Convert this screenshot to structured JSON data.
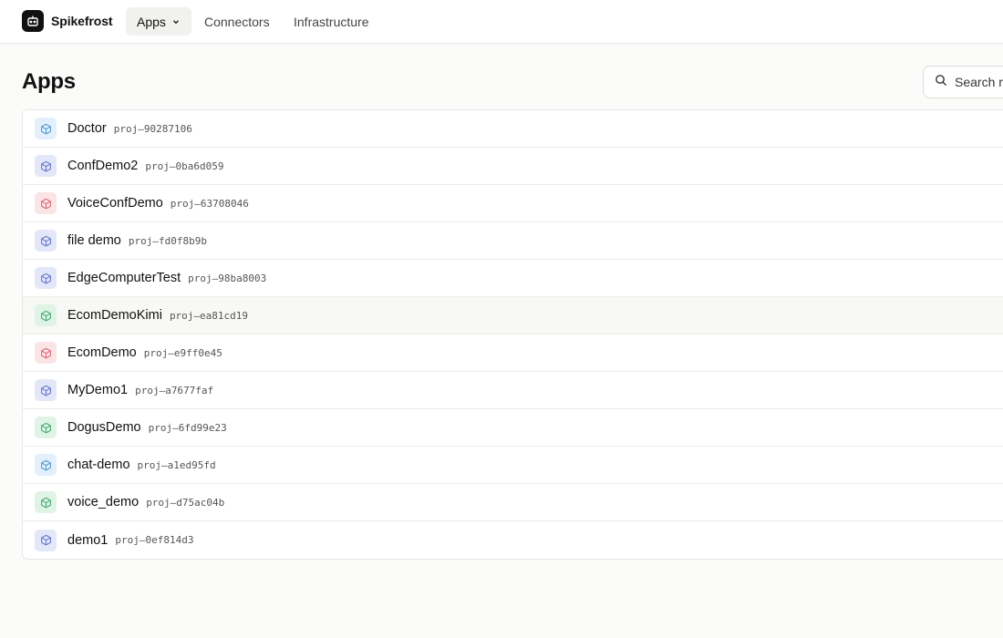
{
  "header": {
    "brand": "Spikefrost",
    "logo_icon": "robot-icon",
    "nav": [
      {
        "label": "Apps",
        "active": true,
        "icon": "chevron-down-icon"
      },
      {
        "label": "Connectors"
      },
      {
        "label": "Infrastructure"
      }
    ]
  },
  "main": {
    "title": "Apps",
    "search": {
      "placeholder": "Search m",
      "icon": "search-icon"
    },
    "apps": [
      {
        "name": "Doctor",
        "id": "proj—90287106",
        "icon": "box-icon",
        "color": "blue"
      },
      {
        "name": "ConfDemo2",
        "id": "proj—0ba6d059",
        "icon": "box-icon",
        "color": "indigo"
      },
      {
        "name": "VoiceConfDemo",
        "id": "proj—63708046",
        "icon": "box-icon",
        "color": "red"
      },
      {
        "name": "file demo",
        "id": "proj—fd0f8b9b",
        "icon": "box-icon",
        "color": "indigo"
      },
      {
        "name": "EdgeComputerTest",
        "id": "proj—98ba8003",
        "icon": "box-icon",
        "color": "indigo"
      },
      {
        "name": "EcomDemoKimi",
        "id": "proj—ea81cd19",
        "icon": "box-icon",
        "color": "green"
      },
      {
        "name": "EcomDemo",
        "id": "proj—e9ff0e45",
        "icon": "box-icon",
        "color": "red"
      },
      {
        "name": "MyDemo1",
        "id": "proj—a7677faf",
        "icon": "box-icon",
        "color": "indigo"
      },
      {
        "name": "DogusDemo",
        "id": "proj—6fd99e23",
        "icon": "box-icon",
        "color": "green"
      },
      {
        "name": "chat-demo",
        "id": "proj—a1ed95fd",
        "icon": "box-icon",
        "color": "blue"
      },
      {
        "name": "voice_demo",
        "id": "proj—d75ac04b",
        "icon": "box-icon",
        "color": "green"
      },
      {
        "name": "demo1",
        "id": "proj—0ef814d3",
        "icon": "box-icon",
        "color": "indigo"
      }
    ]
  },
  "colors": {
    "blue": {
      "bg": "#e3f0fb",
      "fg": "#5b9bd0"
    },
    "indigo": {
      "bg": "#e3e7f8",
      "fg": "#6b7ccc"
    },
    "red": {
      "bg": "#fbe4e6",
      "fg": "#d9707b"
    },
    "green": {
      "bg": "#dff3e6",
      "fg": "#4caf78"
    }
  }
}
